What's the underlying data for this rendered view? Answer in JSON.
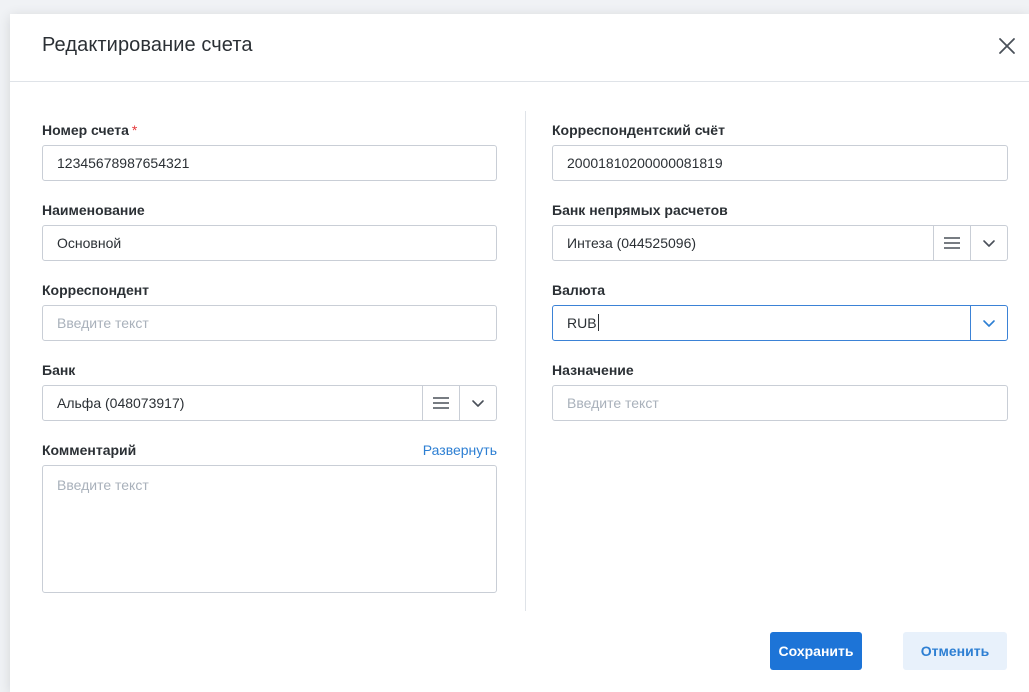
{
  "dialog": {
    "title": "Редактирование счета",
    "close_icon": "close-icon"
  },
  "left": {
    "account_number": {
      "label": "Номер счета",
      "required_mark": "*",
      "value": "12345678987654321"
    },
    "name": {
      "label": "Наименование",
      "value": "Основной"
    },
    "correspondent": {
      "label": "Корреспондент",
      "placeholder": "Введите текст"
    },
    "bank": {
      "label": "Банк",
      "value": "Альфа (048073917)"
    },
    "comment": {
      "label": "Комментарий",
      "expand_link": "Развернуть",
      "placeholder": "Введите текст"
    }
  },
  "right": {
    "corr_account": {
      "label": "Корреспондентский счёт",
      "value": "20001810200000081819"
    },
    "indirect_bank": {
      "label": "Банк непрямых расчетов",
      "value": "Интеза (044525096)"
    },
    "currency": {
      "label": "Валюта",
      "value": "RUB"
    },
    "purpose": {
      "label": "Назначение",
      "placeholder": "Введите текст"
    }
  },
  "actions": {
    "save_label": "Сохранить",
    "cancel_label": "Отменить"
  },
  "colors": {
    "primary": "#1d74d7",
    "link": "#2d7fd3",
    "required": "#e5383b",
    "focus_border": "#3b82d6"
  }
}
